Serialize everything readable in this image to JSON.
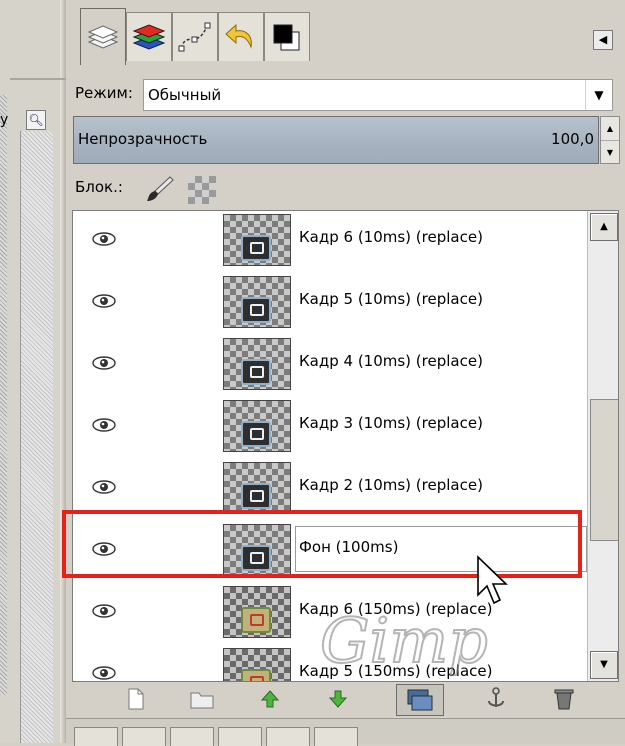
{
  "left_panel": {
    "label": "у",
    "zoom_icon": "zoom-icon",
    "up_icon": "up-arrow-icon"
  },
  "tabs": [
    {
      "icon": "layers-icon",
      "active": true
    },
    {
      "icon": "channels-icon"
    },
    {
      "icon": "paths-icon"
    },
    {
      "icon": "undo-history-icon"
    },
    {
      "icon": "colors-icon"
    }
  ],
  "mode": {
    "label": "Режим:",
    "value": "Обычный"
  },
  "opacity": {
    "label": "Непрозрачность",
    "value": "100,0",
    "fraction": 1.0
  },
  "lock": {
    "label": "Блок.:"
  },
  "layers": [
    {
      "name": "Кадр 6 (10ms) (replace)"
    },
    {
      "name": "Кадр 5 (10ms) (replace)"
    },
    {
      "name": "Кадр 4 (10ms) (replace)"
    },
    {
      "name": "Кадр 3 (10ms) (replace)"
    },
    {
      "name": "Кадр 2 (10ms) (replace)"
    },
    {
      "name": "Фон (100ms)",
      "selected": true
    },
    {
      "name": "Кадр 6 (150ms) (replace)"
    },
    {
      "name": "Кадр 5 (150ms) (replace)"
    }
  ],
  "toolbar": [
    {
      "icon": "new-layer-icon"
    },
    {
      "icon": "new-group-icon"
    },
    {
      "icon": "raise-layer-icon"
    },
    {
      "icon": "lower-layer-icon"
    },
    {
      "icon": "duplicate-layer-icon"
    },
    {
      "icon": "anchor-layer-icon"
    },
    {
      "icon": "delete-layer-icon"
    }
  ],
  "watermark": {
    "text": "Gimp"
  },
  "colors": {
    "highlight": "#e3231a",
    "opacity_bar": "#a7b3c0"
  }
}
